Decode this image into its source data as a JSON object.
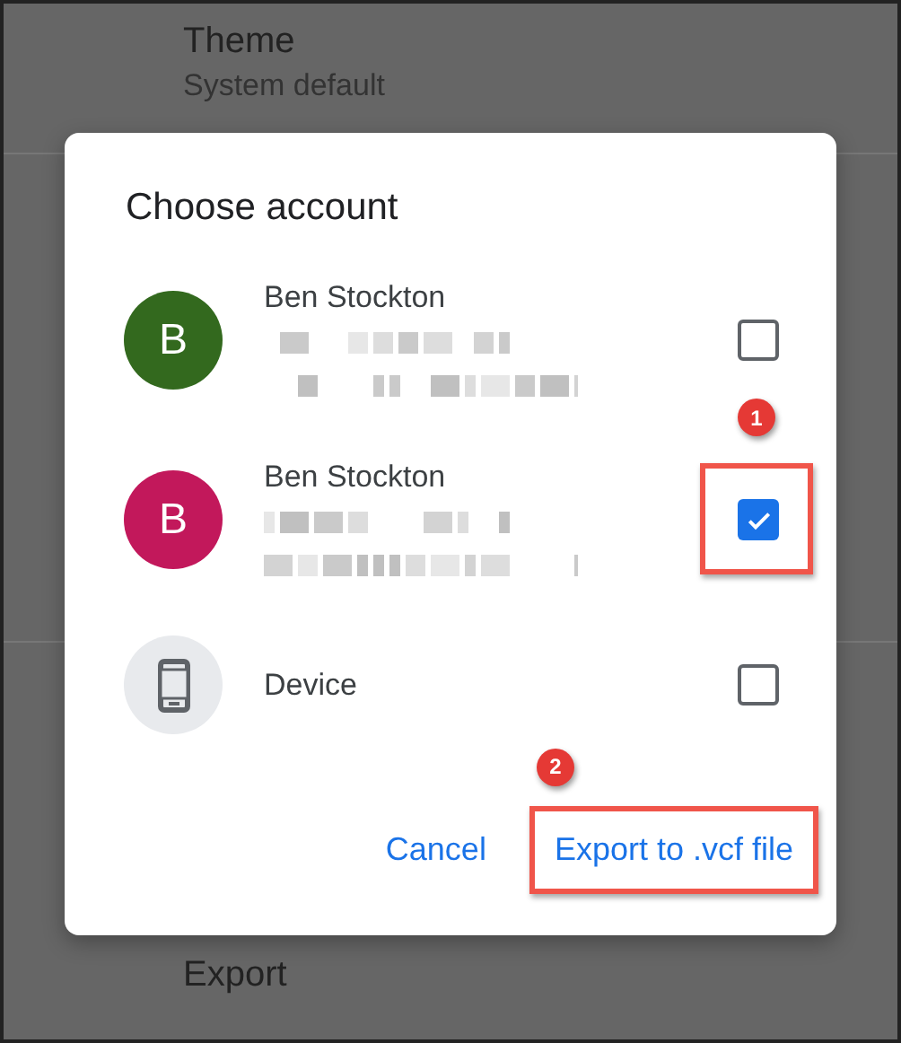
{
  "background": {
    "setting_title": "Theme",
    "setting_value": "System default",
    "next_item": "Export"
  },
  "dialog": {
    "title": "Choose account",
    "accounts": [
      {
        "kind": "person",
        "initial": "B",
        "name": "Ben Stockton",
        "color": "#33691e",
        "details_hidden": true,
        "checked": false
      },
      {
        "kind": "person",
        "initial": "B",
        "name": "Ben Stockton",
        "color": "#c2185b",
        "details_hidden": true,
        "checked": true,
        "callout": "1"
      },
      {
        "kind": "device",
        "name": "Device",
        "checked": false
      }
    ],
    "buttons": [
      {
        "label": "Cancel"
      },
      {
        "label": "Export to .vcf file",
        "callout": "2"
      }
    ]
  }
}
